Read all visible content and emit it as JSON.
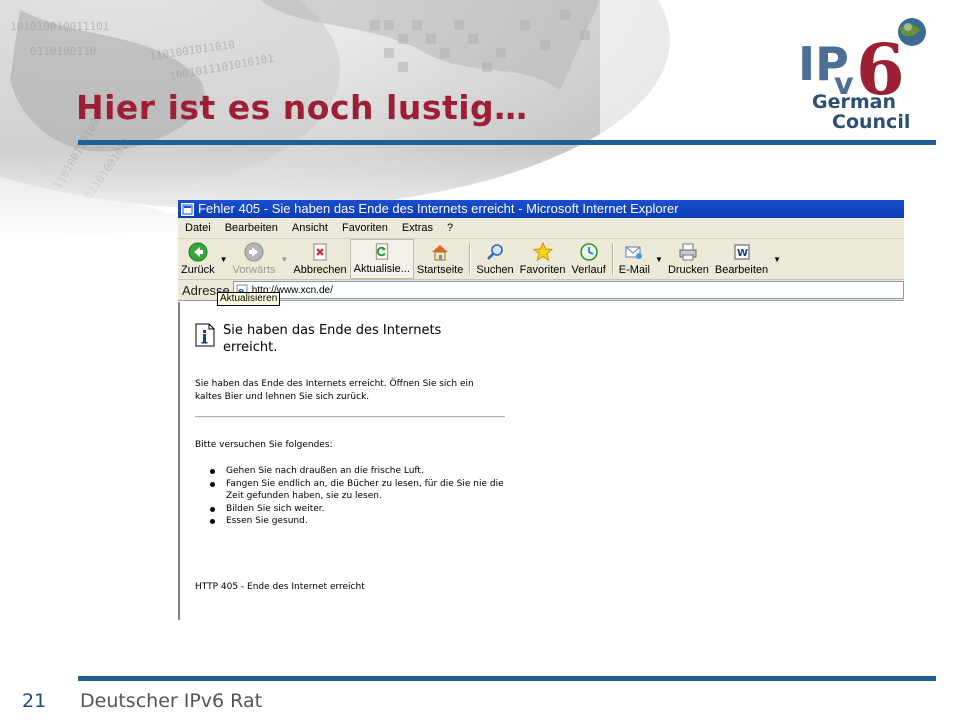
{
  "slide": {
    "title": "Hier ist es noch lustig…",
    "page_number": "21",
    "footer": "Deutscher IPv6 Rat",
    "accent_color": "#9c1f33",
    "rule_color": "#1f5f93"
  },
  "logo": {
    "ip": "IP",
    "v": "v",
    "six": "6",
    "line1": "German",
    "line2": "Council"
  },
  "browser": {
    "window_title": "Fehler 405 - Sie haben das Ende des Internets erreicht - Microsoft Internet Explorer",
    "menu": [
      "Datei",
      "Bearbeiten",
      "Ansicht",
      "Favoriten",
      "Extras",
      "?"
    ],
    "toolbar": {
      "back": "Zurück",
      "forward": "Vorwärts",
      "stop": "Abbrechen",
      "refresh": "Aktualisie...",
      "home": "Startseite",
      "search": "Suchen",
      "favorites": "Favoriten",
      "history": "Verlauf",
      "mail": "E-Mail",
      "print": "Drucken",
      "edit": "Bearbeiten"
    },
    "address_label": "Adresse",
    "address_value": "http://www.xcn.de/",
    "tooltip": "Aktualisieren"
  },
  "page": {
    "heading": "Sie haben das Ende des Internets erreicht.",
    "body": "Sie haben das Ende des Internets erreicht. Öffnen Sie sich ein kaltes Bier und lehnen Sie sich zurück.",
    "try_heading": "Bitte versuchen Sie folgendes:",
    "suggestions": [
      "Gehen Sie nach draußen an die frische Luft.",
      "Fangen Sie endlich an, die Bücher zu lesen, für die Sie nie die Zeit gefunden haben, sie zu lesen.",
      "Bilden Sie sich weiter.",
      "Essen Sie gesund."
    ],
    "status": "HTTP 405 - Ende des Internet erreicht"
  }
}
